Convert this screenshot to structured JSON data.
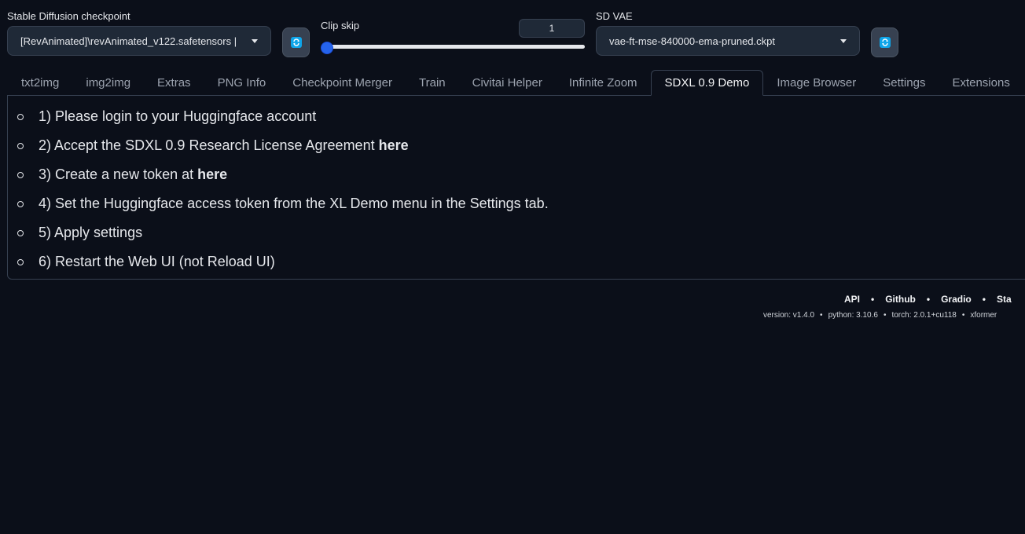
{
  "checkpoint": {
    "label": "Stable Diffusion checkpoint",
    "value": "[RevAnimated]\\revAnimated_v122.safetensors |"
  },
  "clip_skip": {
    "label": "Clip skip",
    "value": "1",
    "slider_fraction": 0.0
  },
  "vae": {
    "label": "SD VAE",
    "value": "vae-ft-mse-840000-ema-pruned.ckpt"
  },
  "icons": {
    "refresh": "refresh-icon",
    "dropdown": "chevron-down-icon",
    "bullet": "circle-bullet-icon"
  },
  "tabs": [
    "txt2img",
    "img2img",
    "Extras",
    "PNG Info",
    "Checkpoint Merger",
    "Train",
    "Civitai Helper",
    "Infinite Zoom",
    "SDXL 0.9 Demo",
    "Image Browser",
    "Settings",
    "Extensions"
  ],
  "active_tab": "SDXL 0.9 Demo",
  "steps": [
    {
      "text": "1) Please login to your Huggingface account",
      "link": ""
    },
    {
      "text": "2) Accept the SDXL 0.9 Research License Agreement",
      "link": "here"
    },
    {
      "text": "3) Create a new token at",
      "link": "here"
    },
    {
      "text": "4) Set the Huggingface access token from the XL Demo menu in the Settings tab.",
      "link": ""
    },
    {
      "text": "5) Apply settings",
      "link": ""
    },
    {
      "text": "6) Restart the Web UI (not Reload UI)",
      "link": ""
    }
  ],
  "footer": {
    "links": [
      "API",
      "Github",
      "Gradio",
      "Sta"
    ],
    "version": "version: v1.4.0",
    "python": "python: 3.10.6",
    "torch": "torch: 2.0.1+cu118",
    "xformers": "xformer"
  },
  "colors": {
    "background": "#0b0f19",
    "accent": "#2563eb",
    "refresh_icon": "#0ea5e9"
  }
}
